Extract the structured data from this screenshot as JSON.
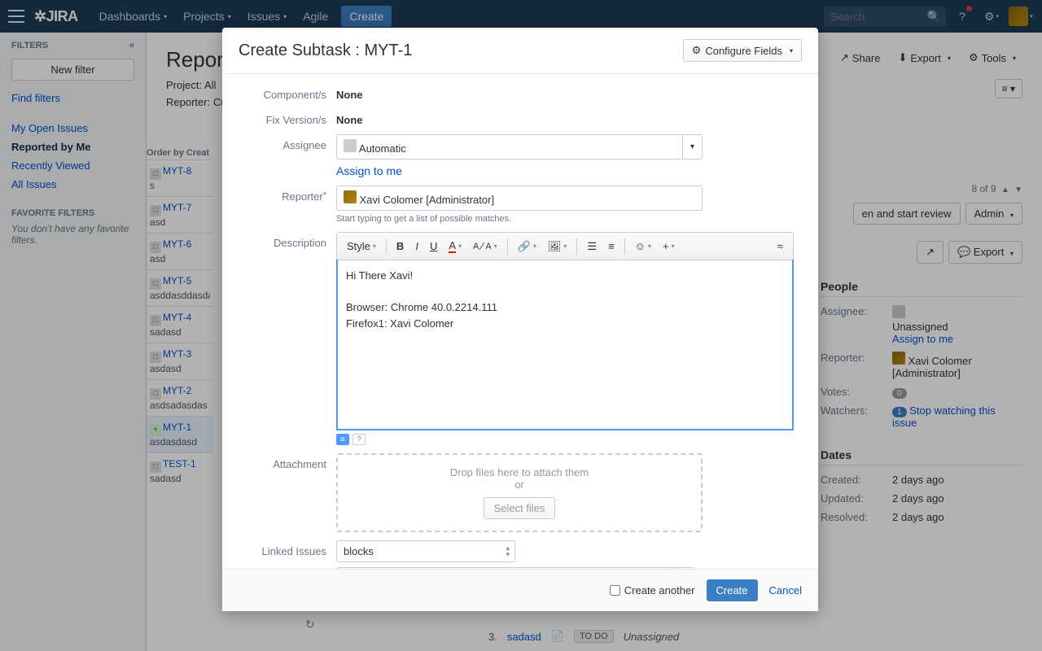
{
  "nav": {
    "dashboards": "Dashboards",
    "projects": "Projects",
    "issues": "Issues",
    "agile": "Agile",
    "create": "Create",
    "search_placeholder": "Search"
  },
  "sidebar": {
    "filters_label": "FILTERS",
    "new_filter": "New filter",
    "find_filters": "Find filters",
    "fav_label": "FAVORITE FILTERS",
    "fav_note": "You don't have any favorite filters.",
    "links": [
      {
        "label": "My Open Issues",
        "bold": false
      },
      {
        "label": "Reported by Me",
        "bold": true
      },
      {
        "label": "Recently Viewed",
        "bold": false
      },
      {
        "label": "All Issues",
        "bold": false
      }
    ]
  },
  "page": {
    "title": "Reporte",
    "project_lbl": "Project:",
    "project_val": "All",
    "reporter_lbl": "Reporter:",
    "reporter_val": "Cur",
    "share": "Share",
    "export": "Export",
    "tools": "Tools",
    "pagecount": "8 of 9",
    "orderby": "Order by Creat",
    "start_review": "en and start review",
    "admin": "Admin",
    "export2": "Export"
  },
  "issues": [
    {
      "key": "MYT-8",
      "sum": "s",
      "type": "sub"
    },
    {
      "key": "MYT-7",
      "sum": "asd",
      "type": "sub"
    },
    {
      "key": "MYT-6",
      "sum": "asd",
      "type": "sub"
    },
    {
      "key": "MYT-5",
      "sum": "asddasddasda",
      "type": "sub"
    },
    {
      "key": "MYT-4",
      "sum": "sadasd",
      "type": "sub"
    },
    {
      "key": "MYT-3",
      "sum": "asdasd",
      "type": "sub"
    },
    {
      "key": "MYT-2",
      "sum": "asdsadasdas",
      "type": "sub"
    },
    {
      "key": "MYT-1",
      "sum": "asdasdasd",
      "type": "story",
      "sel": true
    },
    {
      "key": "TEST-1",
      "sum": "sadasd",
      "type": "sub"
    }
  ],
  "people": {
    "head": "People",
    "assignee_lbl": "Assignee:",
    "assignee_val": "Unassigned",
    "assign_to_me": "Assign to me",
    "reporter_lbl": "Reporter:",
    "reporter_val": "Xavi Colomer [Administrator]",
    "votes_lbl": "Votes:",
    "votes_val": "0",
    "watchers_lbl": "Watchers:",
    "watchers_val": "1",
    "stop_watch": "Stop watching this issue"
  },
  "dates": {
    "head": "Dates",
    "created_lbl": "Created:",
    "created_val": "2 days ago",
    "updated_lbl": "Updated:",
    "updated_val": "2 days ago",
    "resolved_lbl": "Resolved:",
    "resolved_val": "2 days ago"
  },
  "modal": {
    "title": "Create Subtask : MYT-1",
    "configure": "Configure Fields",
    "components_lbl": "Component/s",
    "components_val": "None",
    "fixv_lbl": "Fix Version/s",
    "fixv_val": "None",
    "assignee_lbl": "Assignee",
    "assignee_val": "Automatic",
    "assign_to_me": "Assign to me",
    "reporter_lbl": "Reporter",
    "reporter_val": "Xavi Colomer [Administrator]",
    "reporter_hint": "Start typing to get a list of possible matches.",
    "description_lbl": "Description",
    "style": "Style",
    "desc_line1": "Hi There Xavi!",
    "desc_line2": "Browser: Chrome 40.0.2214.111",
    "desc_line3": "Firefox1: Xavi Colomer",
    "attachment_lbl": "Attachment",
    "drop_text": "Drop files here to attach them",
    "or": "or",
    "select_files": "Select files",
    "linked_lbl": "Linked Issues",
    "linked_val": "blocks",
    "create_another": "Create another",
    "create": "Create",
    "cancel": "Cancel"
  },
  "peek": {
    "num": "3.",
    "sum": "sadasd",
    "status": "TO DO",
    "assignee": "Unassigned"
  }
}
